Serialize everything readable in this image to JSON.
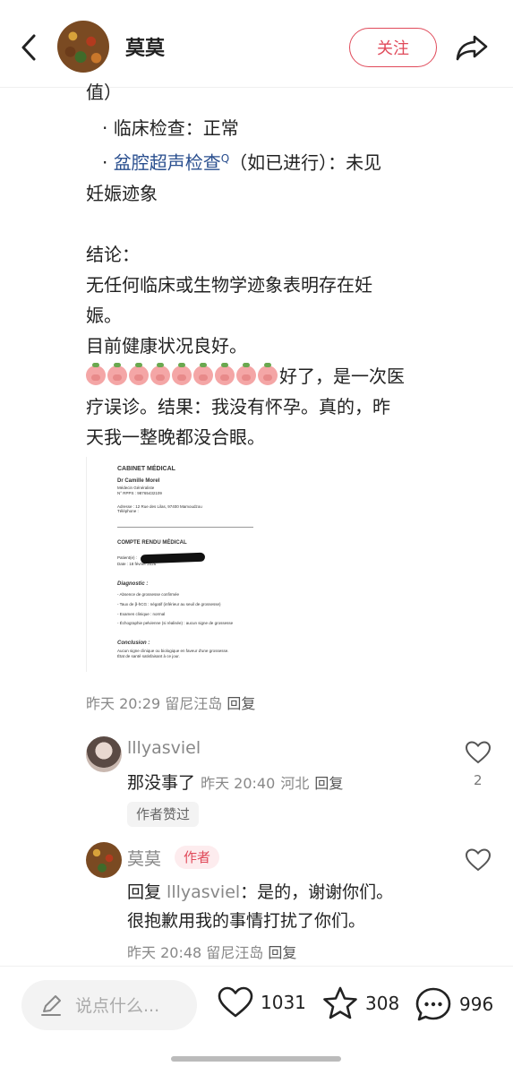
{
  "header": {
    "title": "莫莫",
    "follow_label": "关注"
  },
  "post": {
    "line0": "值）",
    "bullet1": "· 临床检查：正常",
    "bullet2_prefix": "· ",
    "bullet2_link": "盆腔超声检查",
    "bullet2_sup": "Q",
    "bullet2_rest": "（如已进行）：未见",
    "bullet2_cont": "妊娠迹象",
    "conclusion_heading": "结论：",
    "conclusion1": "无任何临床或生物学迹象表明存在妊",
    "conclusion2": "娠。",
    "conclusion3": "目前健康状况良好。",
    "reaction_line1": "好了，是一次医",
    "reaction_line2": "疗误诊。结果：我没有怀孕。真的，昨",
    "reaction_line3": "天我一整晚都没合眼。",
    "meta_time": "昨天 20:29",
    "meta_location": "留尼汪岛",
    "meta_reply": "回复"
  },
  "document": {
    "cabinet": "CABINET MÉDICAL",
    "doctor": "Dr Camille Morel",
    "specialty": "Médecin Généraliste",
    "rpps": "N° RPPS : 98765432109",
    "address": "Adresse : 12 Rue des Lilas, 97400 Mamoudzou",
    "phone": "Téléphone :",
    "report_title": "COMPTE RENDU MÉDICAL",
    "patient": "Patient(e) :",
    "date": "Date : 18 février 2026",
    "diagnostic": "Diagnostic :",
    "items": [
      "- Absence de grossesse confirmée",
      "- Taux de β-hCG : négatif (inférieur au seuil de grossesse)",
      "- Examen clinique : normal",
      "- Échographie pelvienne (si réalisée) : aucun signe de grossesse"
    ],
    "conclusion": "Conclusion :",
    "conclusion_text1": "Aucun signe clinique ou biologique en faveur d'une grossesse.",
    "conclusion_text2": "État de santé satisfaisant à ce jour."
  },
  "comments": [
    {
      "name": "lllyasviel",
      "text": "那没事了",
      "time": "昨天 20:40",
      "location": "河北",
      "reply": "回复",
      "badge": "作者赞过",
      "likes": "2"
    },
    {
      "name": "莫莫",
      "author_badge": "作者",
      "text_prefix": "回复 ",
      "mention": "lllyasviel",
      "text_rest": "：是的，谢谢你们。",
      "text_line2": "很抱歉用我的事情打扰了你们。",
      "time": "昨天 20:48",
      "location": "留尼汪岛",
      "reply": "回复"
    }
  ],
  "bottom_bar": {
    "input_placeholder": "说点什么...",
    "likes": "1031",
    "stars": "308",
    "comments": "996"
  },
  "colors": {
    "accent": "#e04a5a",
    "link": "#2a4f8f",
    "muted": "#888888"
  }
}
